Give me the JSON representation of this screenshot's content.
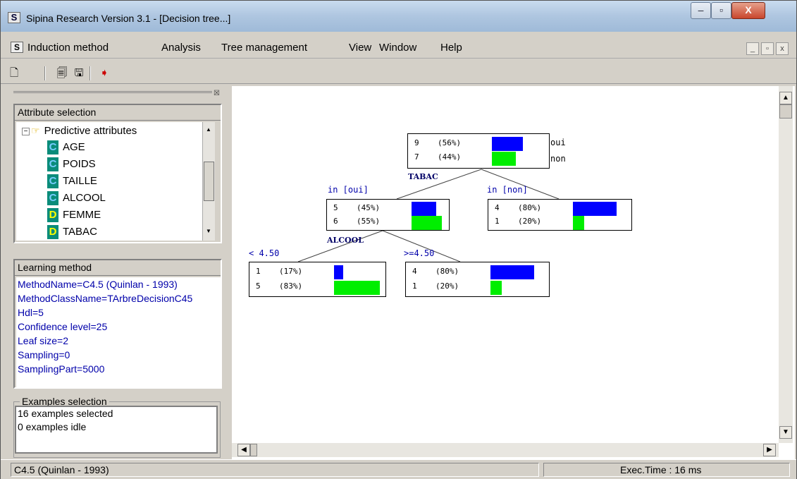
{
  "window": {
    "title": "Sipina Research Version 3.1 - [Decision tree...]",
    "min": "–",
    "max": "▫",
    "close": "X"
  },
  "menu": {
    "items": [
      "Induction method",
      "Analysis",
      "Tree management",
      "View",
      "Window",
      "Help"
    ],
    "mdi": [
      "_",
      "▫",
      "x"
    ]
  },
  "attributes": {
    "header": "Attribute selection",
    "group": "Predictive attributes",
    "items": [
      {
        "type": "C",
        "name": "AGE"
      },
      {
        "type": "C",
        "name": "POIDS"
      },
      {
        "type": "C",
        "name": "TAILLE"
      },
      {
        "type": "C",
        "name": "ALCOOL"
      },
      {
        "type": "D",
        "name": "FEMME"
      },
      {
        "type": "D",
        "name": "TABAC"
      }
    ]
  },
  "learning": {
    "header": "Learning method",
    "lines": [
      "MethodName=C4.5 (Quinlan - 1993)",
      "MethodClassName=TArbreDecisionC45",
      "Hdl=5",
      "Confidence level=25",
      "Leaf size=2",
      "Sampling=0",
      "SamplingPart=5000"
    ]
  },
  "examples": {
    "header": "Examples selection",
    "lines": [
      "16 examples selected",
      "0 examples idle"
    ]
  },
  "status": {
    "method": "C4.5 (Quinlan - 1993)",
    "exec": "Exec.Time : 16 ms"
  },
  "colors": {
    "oui": "#0000ff",
    "non": "#00e000"
  },
  "tree": {
    "classes": [
      "oui",
      "non"
    ],
    "root": {
      "counts": [
        "9",
        "7"
      ],
      "pcts": [
        "(56%)",
        "(44%)"
      ],
      "fracs": [
        0.56,
        0.44
      ],
      "split": "TABAC"
    },
    "n_oui": {
      "edge": "in [oui]",
      "counts": [
        "5",
        "6"
      ],
      "pcts": [
        "(45%)",
        "(55%)"
      ],
      "fracs": [
        0.45,
        0.55
      ],
      "split": "ALCOOL"
    },
    "n_non": {
      "edge": "in [non]",
      "counts": [
        "4",
        "1"
      ],
      "pcts": [
        "(80%)",
        "(20%)"
      ],
      "fracs": [
        0.8,
        0.2
      ]
    },
    "n_lt": {
      "edge": "< 4.50",
      "counts": [
        "1",
        "5"
      ],
      "pcts": [
        "(17%)",
        "(83%)"
      ],
      "fracs": [
        0.17,
        0.83
      ]
    },
    "n_ge": {
      "edge": ">=4.50",
      "counts": [
        "4",
        "1"
      ],
      "pcts": [
        "(80%)",
        "(20%)"
      ],
      "fracs": [
        0.8,
        0.2
      ]
    }
  }
}
